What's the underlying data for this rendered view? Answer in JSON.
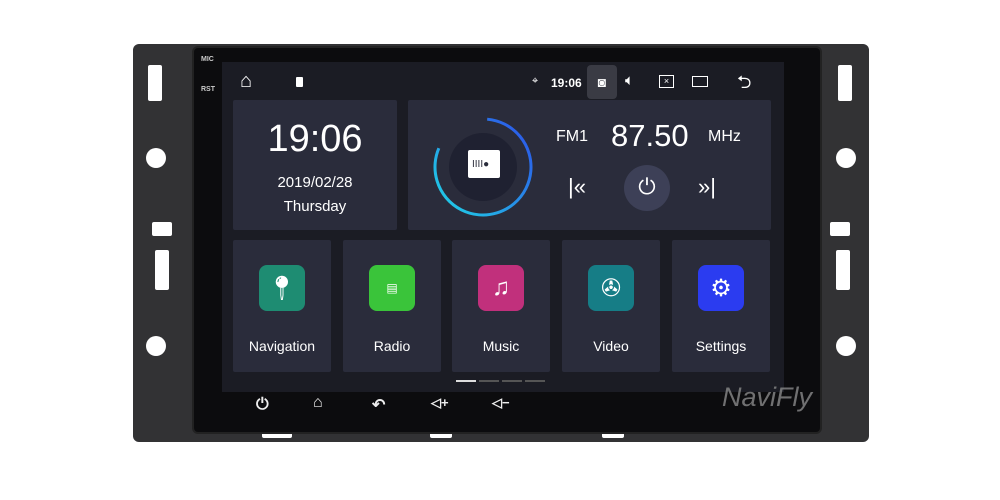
{
  "device": {
    "mic_label": "MIC",
    "rst_label": "RST",
    "watermark": "NaviFly"
  },
  "status_bar": {
    "time": "19:06",
    "icons": [
      "home-icon",
      "sd-card-icon",
      "location-icon",
      "screenshot-icon",
      "volume-icon",
      "close-app-icon",
      "recent-apps-icon",
      "back-icon"
    ]
  },
  "clock": {
    "time": "19:06",
    "date": "2019/02/28",
    "day": "Thursday"
  },
  "radio": {
    "band": "FM1",
    "frequency": "87.50",
    "unit": "MHz",
    "progress_arc": 0.8
  },
  "apps": [
    {
      "label": "Navigation",
      "icon": "location-pin-icon",
      "color": "#1e8c72"
    },
    {
      "label": "Radio",
      "icon": "radio-icon",
      "color": "#3ac43a"
    },
    {
      "label": "Music",
      "icon": "music-note-icon",
      "color": "#c1307c"
    },
    {
      "label": "Video",
      "icon": "film-reel-icon",
      "color": "#167d86"
    },
    {
      "label": "Settings",
      "icon": "gear-icon",
      "color": "#2b3cf0"
    }
  ],
  "page_indicator": {
    "pages": 4,
    "current": 1
  },
  "hard_keys": [
    "power-icon",
    "home-icon",
    "back-icon",
    "volume-up-icon",
    "volume-down-icon"
  ]
}
